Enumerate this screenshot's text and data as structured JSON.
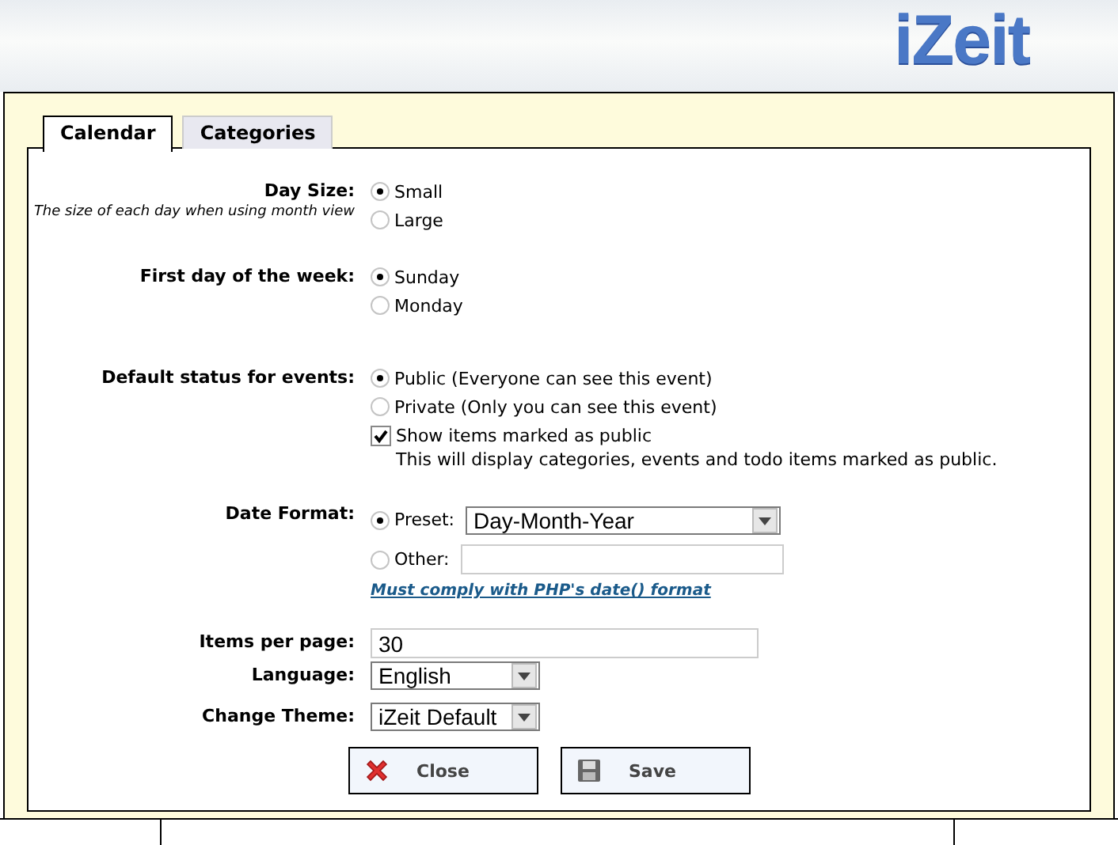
{
  "header": {
    "logo": "iZeit"
  },
  "tabs": [
    {
      "label": "Calendar",
      "selected": true
    },
    {
      "label": "Categories",
      "selected": false
    }
  ],
  "settings": [
    {
      "kind": "radio",
      "label": "Day Size:",
      "hint": "The size of each day when using month view",
      "options": [
        {
          "label": "Small",
          "selected": true
        },
        {
          "label": "Large",
          "selected": false
        }
      ]
    },
    {
      "kind": "radio",
      "label": "First day of the week:",
      "options": [
        {
          "label": "Sunday",
          "selected": true
        },
        {
          "label": "Monday",
          "selected": false
        }
      ]
    },
    {
      "kind": "radio",
      "label": "Default status for events:",
      "options": [
        {
          "label": "Public (Everyone can see this event)",
          "selected": true
        },
        {
          "label": "Private (Only you can see this event)",
          "selected": false
        }
      ],
      "checkbox": {
        "label": "Show items marked as public",
        "checked": true,
        "description": "This will display categories, events and todo items marked as public."
      }
    },
    {
      "kind": "date_format",
      "label": "Date Format:",
      "preset": {
        "label": "Preset:",
        "selected": true,
        "value": "Day-Month-Year"
      },
      "other": {
        "label": "Other:",
        "selected": false
      },
      "link": "Must comply with PHP's date() format"
    },
    {
      "kind": "text",
      "label": "Items per page:",
      "value": "30"
    },
    {
      "kind": "select",
      "label": "Language:",
      "value": "English"
    },
    {
      "kind": "select",
      "label": "Change Theme:",
      "value": "iZeit Default"
    }
  ],
  "buttons": [
    {
      "label": "Close",
      "kind": "close"
    },
    {
      "label": "Save",
      "kind": "save"
    }
  ]
}
